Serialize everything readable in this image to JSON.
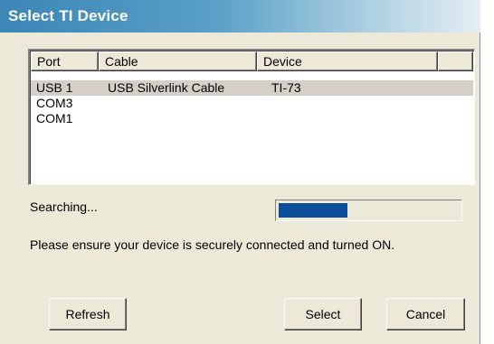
{
  "window": {
    "title": "Select TI Device"
  },
  "listview": {
    "columns": [
      "Port",
      "Cable",
      "Device"
    ],
    "rows": [
      {
        "port": "USB 1",
        "cable": "USB Silverlink Cable",
        "device": "TI-73",
        "selected": true
      },
      {
        "port": "COM3",
        "cable": "",
        "device": "",
        "selected": false
      },
      {
        "port": "COM1",
        "cable": "",
        "device": "",
        "selected": false
      }
    ]
  },
  "status": {
    "label": "Searching...",
    "progress_fraction": 0.38,
    "progress_color": "#0a4e99"
  },
  "message": "Please ensure your device is securely connected and turned ON.",
  "buttons": {
    "refresh": "Refresh",
    "select": "Select",
    "cancel": "Cancel"
  },
  "colors": {
    "dialog_bg": "#ece9d8",
    "title_gradient_start": "#3a86b6"
  }
}
